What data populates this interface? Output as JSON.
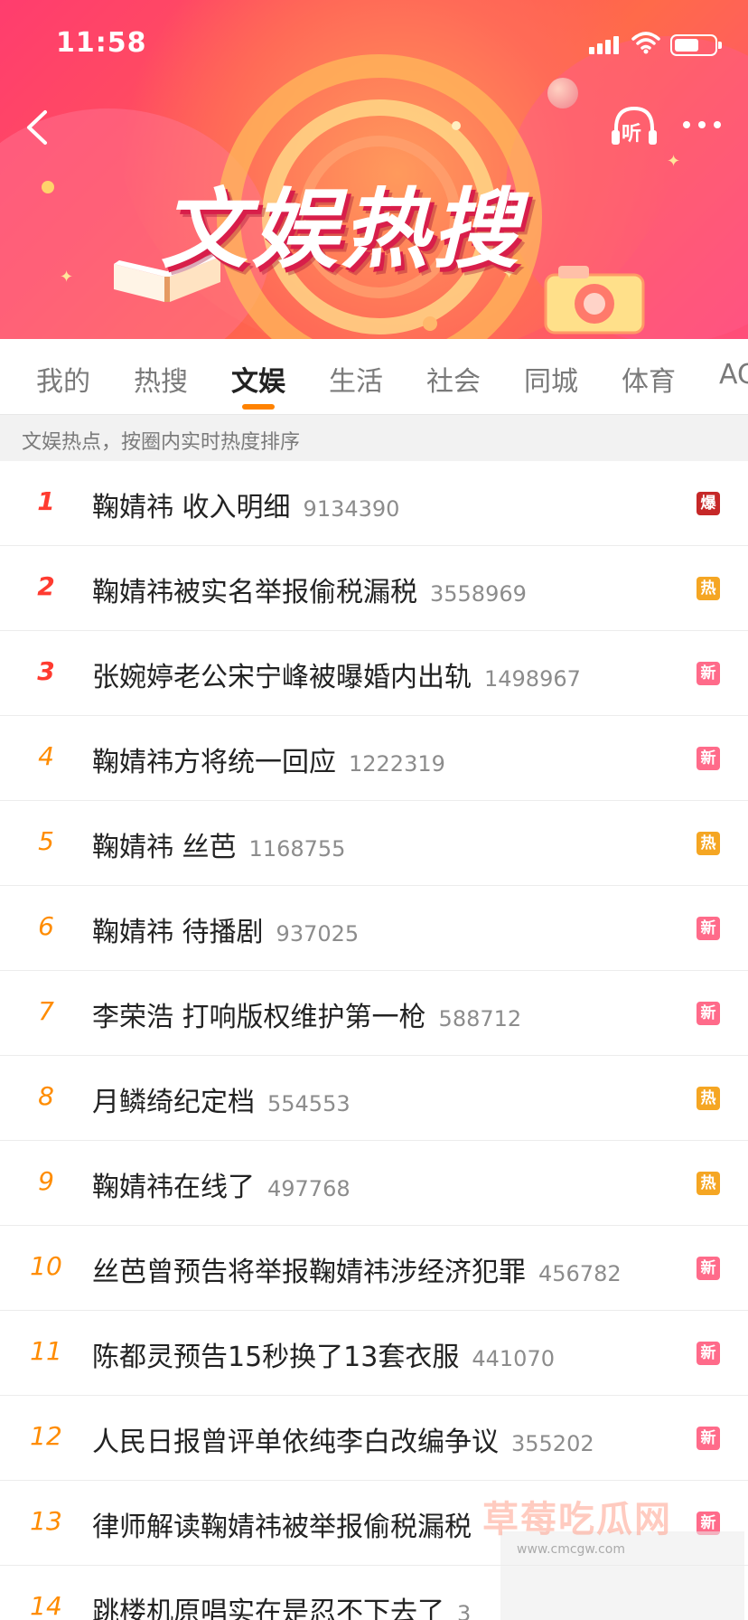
{
  "status_bar": {
    "time": "11:58"
  },
  "banner": {
    "title": "文娱热搜",
    "listen_label": "听"
  },
  "tabs": [
    {
      "label": "我的",
      "active": false
    },
    {
      "label": "热搜",
      "active": false
    },
    {
      "label": "文娱",
      "active": true
    },
    {
      "label": "生活",
      "active": false
    },
    {
      "label": "社会",
      "active": false
    },
    {
      "label": "同城",
      "active": false
    },
    {
      "label": "体育",
      "active": false
    },
    {
      "label": "AC",
      "active": false
    }
  ],
  "subheader": "文娱热点，按圈内实时热度排序",
  "items": [
    {
      "rank": "1",
      "title": "鞠婧祎 收入明细",
      "count": "9134390",
      "badge": "爆",
      "badge_color": "#c62828"
    },
    {
      "rank": "2",
      "title": "鞠婧祎被实名举报偷税漏税",
      "count": "3558969",
      "badge": "热",
      "badge_color": "#f5a623"
    },
    {
      "rank": "3",
      "title": "张婉婷老公宋宁峰被曝婚内出轨",
      "count": "1498967",
      "badge": "新",
      "badge_color": "#ff6b8a"
    },
    {
      "rank": "4",
      "title": "鞠婧祎方将统一回应",
      "count": "1222319",
      "badge": "新",
      "badge_color": "#ff6b8a"
    },
    {
      "rank": "5",
      "title": "鞠婧祎 丝芭",
      "count": "1168755",
      "badge": "热",
      "badge_color": "#f5a623"
    },
    {
      "rank": "6",
      "title": "鞠婧祎 待播剧",
      "count": "937025",
      "badge": "新",
      "badge_color": "#ff6b8a"
    },
    {
      "rank": "7",
      "title": "李荣浩 打响版权维护第一枪",
      "count": "588712",
      "badge": "新",
      "badge_color": "#ff6b8a"
    },
    {
      "rank": "8",
      "title": "月鳞绮纪定档",
      "count": "554553",
      "badge": "热",
      "badge_color": "#f5a623"
    },
    {
      "rank": "9",
      "title": "鞠婧祎在线了",
      "count": "497768",
      "badge": "热",
      "badge_color": "#f5a623"
    },
    {
      "rank": "10",
      "title": "丝芭曾预告将举报鞠婧祎涉经济犯罪",
      "count": "456782",
      "badge": "新",
      "badge_color": "#ff6b8a"
    },
    {
      "rank": "11",
      "title": "陈都灵预告15秒换了13套衣服",
      "count": "441070",
      "badge": "新",
      "badge_color": "#ff6b8a"
    },
    {
      "rank": "12",
      "title": "人民日报曾评单依纯李白改编争议",
      "count": "355202",
      "badge": "新",
      "badge_color": "#ff6b8a"
    },
    {
      "rank": "13",
      "title": "律师解读鞠婧祎被举报偷税漏税",
      "count": "",
      "badge": "新",
      "badge_color": "#ff6b8a"
    },
    {
      "rank": "14",
      "title": "跳楼机原唱实在是忍不下去了",
      "count": "3",
      "badge": "",
      "badge_color": "#ff6b8a"
    }
  ],
  "watermark": {
    "text": "草莓吃瓜网",
    "url": "www.cmcgw.com"
  },
  "colors": {
    "accent": "#ff8200",
    "rank_top": "#ff3b30",
    "rank": "#ff8c00"
  }
}
